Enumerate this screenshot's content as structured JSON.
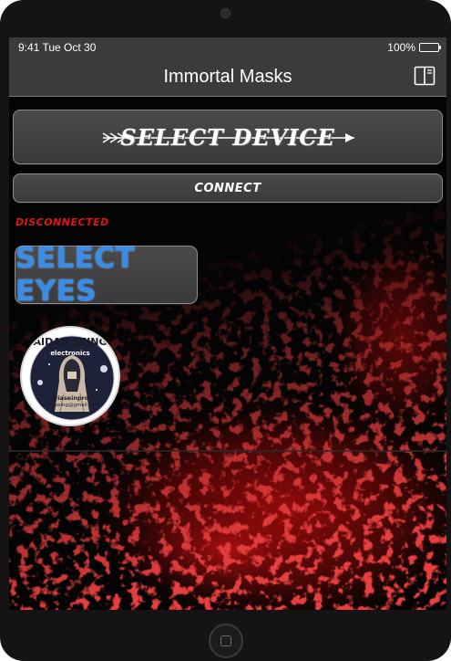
{
  "status_bar": {
    "time": "9:41 Tue Oct 30",
    "battery": "100%"
  },
  "nav": {
    "title": "Immortal Masks"
  },
  "buttons": {
    "select_device": "SELECT DEVICE",
    "connect": "CONNECT",
    "select_eyes": "SELECT EYES"
  },
  "connection_status": "DISCONNECTED",
  "logo": {
    "title": "AIDAN SEING",
    "subtitle": "electronics",
    "handle": "@iaseinpro",
    "email": "aidanseing@gmail.com"
  },
  "colors": {
    "status_disconnected": "#e11414",
    "select_eyes_text": "#3a8de6",
    "bar_background": "#3b3b3d",
    "splatter_red": "#c41010"
  },
  "icons": {
    "book": "book-icon",
    "battery": "battery-icon",
    "home": "home-button-icon"
  }
}
